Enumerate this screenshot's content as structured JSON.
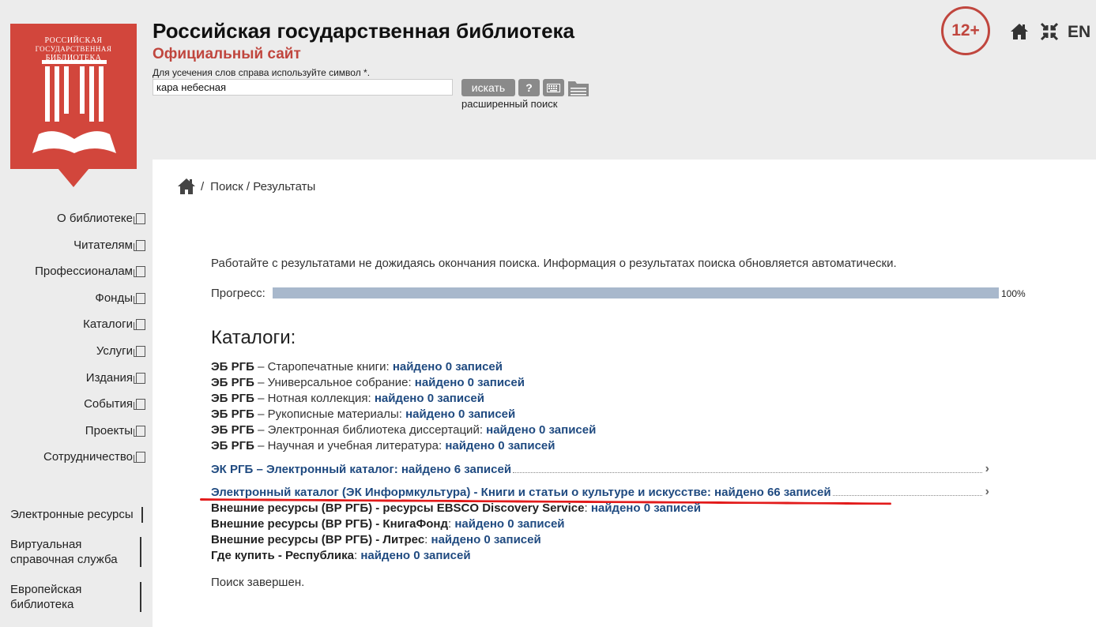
{
  "logo": {
    "line1": "РОССИЙСКАЯ",
    "line2": "ГОСУДАРСТВЕННАЯ",
    "line3": "БИБЛИОТЕКА"
  },
  "header": {
    "title": "Российская государственная библиотека",
    "subtitle": "Официальный сайт",
    "age_rating": "12+",
    "lang": "EN",
    "accent_color": "#c0463e"
  },
  "search": {
    "hint": "Для усечения слов справа используйте символ *.",
    "value": "кара небесная",
    "button_label": "искать",
    "help_label": "?",
    "advanced_label": "расширенный поиск"
  },
  "sidebar": {
    "nav": [
      "О библиотеке",
      "Читателям",
      "Профессионалам",
      "Фонды",
      "Каталоги",
      "Услуги",
      "Издания",
      "События",
      "Проекты",
      "Сотрудничество"
    ],
    "resources": [
      "Электронные ресурсы",
      "Виртуальная справочная служба",
      "Европейская библиотека"
    ]
  },
  "breadcrumb": {
    "separator": "/",
    "path": "Поиск / Результаты"
  },
  "results": {
    "info": "Работайте с результатами не дожидаясь окончания поиска. Информация о результатах поиска обновляется автоматически.",
    "progress_label": "Прогресс:",
    "progress_value": 100,
    "progress_text": "100%",
    "catalogs_heading": "Каталоги:",
    "eb_rows": [
      {
        "source": "ЭБ РГБ",
        "name": " – Старопечатные книги: ",
        "count": "найдено 0 записей"
      },
      {
        "source": "ЭБ РГБ",
        "name": " – Универсальное собрание: ",
        "count": "найдено 0 записей"
      },
      {
        "source": "ЭБ РГБ",
        "name": " – Нотная коллекция: ",
        "count": "найдено 0 записей"
      },
      {
        "source": "ЭБ РГБ",
        "name": " – Рукописные материалы: ",
        "count": "найдено 0 записей"
      },
      {
        "source": "ЭБ РГБ",
        "name": " – Электронная библиотека диссертаций: ",
        "count": "найдено 0 записей"
      },
      {
        "source": "ЭБ РГБ",
        "name": " – Научная и учебная литература: ",
        "count": "найдено 0 записей"
      }
    ],
    "link_rows": [
      {
        "text": "ЭК РГБ – Электронный каталог: найдено 6 записей"
      },
      {
        "text": "Электронный каталог (ЭК Информкультура) - Книги и статьи о культуре и искусстве: найдено 66 записей"
      }
    ],
    "ext_rows": [
      {
        "source": "Внешние ресурсы (ВР РГБ) - ресурсы EBSCO Discovery Service",
        "sep": ": ",
        "count": "найдено 0 записей"
      },
      {
        "source": "Внешние ресурсы (ВР РГБ) - КнигаФонд",
        "sep": ": ",
        "count": "найдено 0 записей"
      },
      {
        "source": "Внешние ресурсы (ВР РГБ) - Литрес",
        "sep": ": ",
        "count": "найдено 0 записей"
      },
      {
        "source": "Где купить - Республика",
        "sep": ": ",
        "count": "найдено 0 записей"
      }
    ],
    "done": "Поиск завершен."
  }
}
